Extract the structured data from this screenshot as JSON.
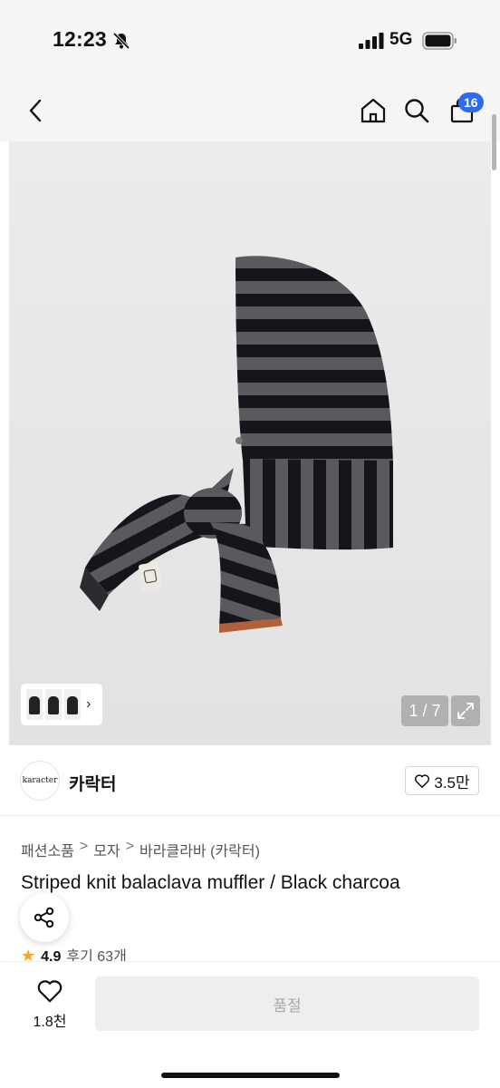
{
  "status_bar": {
    "time": "12:23",
    "network": "5G"
  },
  "header": {
    "cart_badge": "16"
  },
  "gallery": {
    "page_counter": "1 / 7"
  },
  "brand": {
    "logo_text": "karacter",
    "name": "카락터",
    "likes": "3.5만"
  },
  "breadcrumb": [
    "패션소품",
    "모자",
    "바라클라바 (카락터)"
  ],
  "breadcrumb_separator": ">",
  "product": {
    "title": "Striped knit balaclava muffler / Black charcoa",
    "rating": "4.9",
    "review_count": "후기 63개"
  },
  "bottom_bar": {
    "wish_count": "1.8천",
    "soldout_label": "품절"
  },
  "icons": {
    "bell": "bell-slash-icon",
    "signal": "signal-icon",
    "battery": "battery-icon",
    "back": "chevron-left-icon",
    "home": "home-icon",
    "search": "search-icon",
    "cart": "shopping-bag-icon",
    "expand": "expand-icon",
    "heart": "heart-icon",
    "share": "share-icon",
    "star": "star-icon"
  },
  "colors": {
    "badge": "#2f6bed",
    "star": "#f5a623",
    "soldout_bg": "#eeeeee"
  }
}
